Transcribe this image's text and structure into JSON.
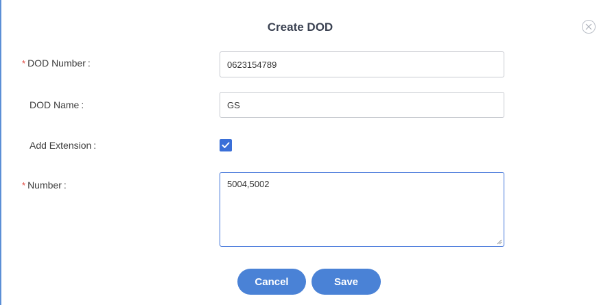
{
  "dialog": {
    "title": "Create DOD",
    "close_icon": "close-circle-icon"
  },
  "form": {
    "dod_number": {
      "required_mark": "*",
      "label": "DOD Number",
      "colon": ":",
      "value": "0623154789"
    },
    "dod_name": {
      "label": "DOD Name",
      "colon": ":",
      "value": "GS"
    },
    "add_extension": {
      "label": "Add Extension",
      "colon": ":",
      "checked": true,
      "icon": "check-icon"
    },
    "number": {
      "required_mark": "*",
      "label": "Number",
      "colon": ":",
      "value": "5004,5002"
    }
  },
  "buttons": {
    "cancel_label": "Cancel",
    "save_label": "Save"
  },
  "colors": {
    "accent": "#3a6fd8",
    "button": "#4a82d6",
    "required": "#e0443b"
  }
}
